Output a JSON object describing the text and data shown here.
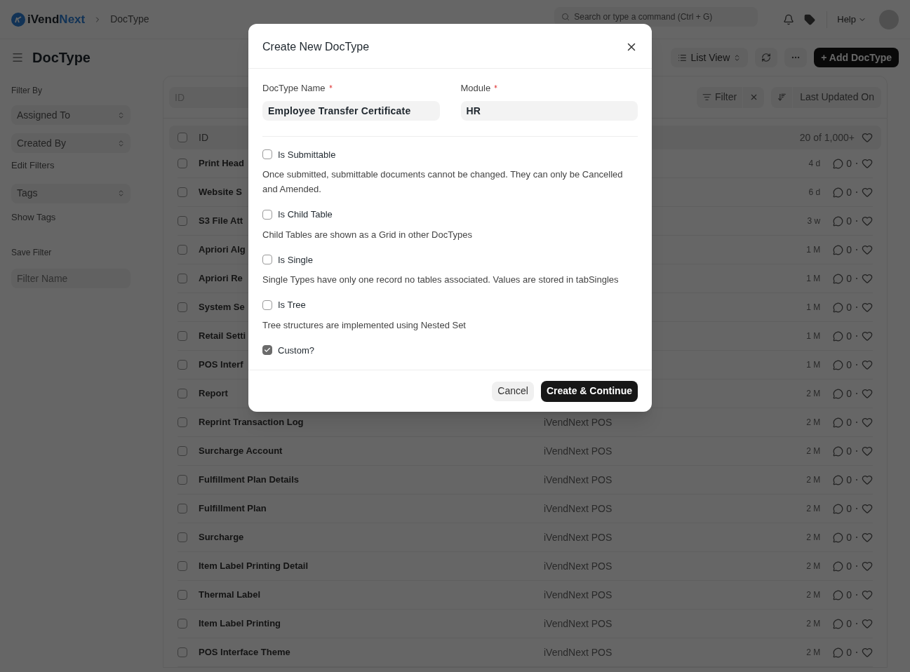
{
  "topbar": {
    "brand_prefix": "iVend",
    "brand_suffix": "Next",
    "breadcrumb": "DocType",
    "search": {
      "placeholder": "Search or type a command (Ctrl + G)"
    },
    "help": "Help"
  },
  "page": {
    "title": "DocType",
    "view": "List View",
    "add_button": "+ Add DocType"
  },
  "sidebar": {
    "filter_by": "Filter By",
    "filters": [
      {
        "label": "Assigned To"
      },
      {
        "label": "Created By"
      }
    ],
    "edit_filters": "Edit Filters",
    "tags": "Tags",
    "show_tags": "Show Tags",
    "save_filter": "Save Filter",
    "filter_name": {
      "placeholder": "Filter Name"
    }
  },
  "list": {
    "id_field": {
      "placeholder": "ID"
    },
    "filter": "Filter",
    "sort": "Last Updated On",
    "header": {
      "label": "ID",
      "checked": false,
      "count": "20 of 1,000+"
    },
    "rows": [
      {
        "name": "Print Head",
        "time": "4 d",
        "comments": "0",
        "checked": false
      },
      {
        "name": "Website S",
        "time": "6 d",
        "comments": "0",
        "checked": false
      },
      {
        "name": "S3 File Att",
        "time": "3 w",
        "comments": "0",
        "checked": false
      },
      {
        "name": "Apriori Alg",
        "time": "1 M",
        "comments": "0",
        "checked": false
      },
      {
        "name": "Apriori Re",
        "time": "1 M",
        "comments": "0",
        "checked": false
      },
      {
        "name": "System Se",
        "time": "1 M",
        "comments": "0",
        "checked": false
      },
      {
        "name": "Retail Setti",
        "time": "1 M",
        "comments": "0",
        "checked": false
      },
      {
        "name": "POS Interf",
        "time": "1 M",
        "comments": "0",
        "checked": false
      },
      {
        "name": "Report",
        "time": "2 M",
        "comments": "0",
        "checked": false
      },
      {
        "name": "Reprint Transaction Log",
        "module": "iVendNext POS",
        "time": "2 M",
        "comments": "0",
        "checked": false
      },
      {
        "name": "Surcharge Account",
        "module": "iVendNext POS",
        "time": "2 M",
        "comments": "0",
        "checked": false
      },
      {
        "name": "Fulfillment Plan Details",
        "module": "iVendNext POS",
        "time": "2 M",
        "comments": "0",
        "checked": false
      },
      {
        "name": "Fulfillment Plan",
        "module": "iVendNext POS",
        "time": "2 M",
        "comments": "0",
        "checked": false
      },
      {
        "name": "Surcharge",
        "module": "iVendNext POS",
        "time": "2 M",
        "comments": "0",
        "checked": false
      },
      {
        "name": "Item Label Printing Detail",
        "module": "iVendNext POS",
        "time": "2 M",
        "comments": "0",
        "checked": false
      },
      {
        "name": "Thermal Label",
        "module": "iVendNext POS",
        "time": "2 M",
        "comments": "0",
        "checked": false
      },
      {
        "name": "Item Label Printing",
        "module": "iVendNext POS",
        "time": "2 M",
        "comments": "0",
        "checked": false
      },
      {
        "name": "POS Interface Theme",
        "module": "iVendNext POS",
        "time": "2 M",
        "comments": "0",
        "checked": false
      }
    ]
  },
  "dialog": {
    "title": "Create New DocType",
    "fields": [
      {
        "label": "DocType Name",
        "required": true,
        "value": "Employee Transfer Certificate"
      },
      {
        "label": "Module",
        "required": true,
        "value": "HR"
      }
    ],
    "options": [
      {
        "label": "Is Submittable",
        "checked": false,
        "description": "Once submitted, submittable documents cannot be changed. They can only be Cancelled and Amended."
      },
      {
        "label": "Is Child Table",
        "checked": false,
        "description": "Child Tables are shown as a Grid in other DocTypes"
      },
      {
        "label": "Is Single",
        "checked": false,
        "description": "Single Types have only one record no tables associated. Values are stored in tabSingles"
      },
      {
        "label": "Is Tree",
        "checked": false,
        "description": "Tree structures are implemented using Nested Set"
      },
      {
        "label": "Custom?",
        "checked": true
      }
    ],
    "cancel": "Cancel",
    "primary": "Create & Continue"
  }
}
